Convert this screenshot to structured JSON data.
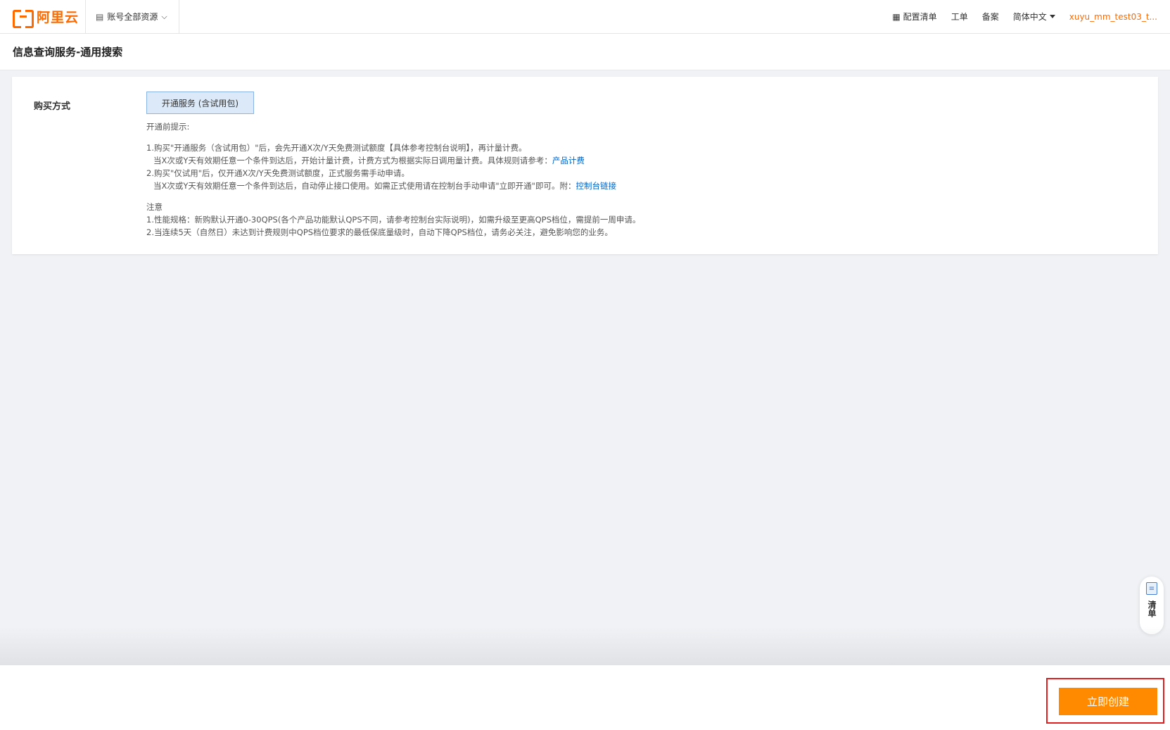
{
  "topbar": {
    "logo_text": "阿里云",
    "account_scope": "账号全部资源",
    "account_scope_icon": "server-list-icon",
    "nav": [
      {
        "label": "配置清单",
        "icon": "list-doc-icon"
      },
      {
        "label": "工单"
      },
      {
        "label": "备案"
      },
      {
        "label": "简体中文"
      }
    ],
    "user": "xuyu_mm_test03_t..."
  },
  "page": {
    "title": "信息查询服务-通用搜索"
  },
  "form": {
    "purchase_label": "购买方式",
    "option_label": "开通服务 (含试用包)",
    "notes": {
      "heading": "开通前提示:",
      "line1": "1.购买\"开通服务（含试用包）\"后，会先开通X次/Y天免费测试额度【具体参考控制台说明】，再计量计费。",
      "line2_prefix": "当X次或Y天有效期任意一个条件到达后，开始计量计费，计费方式为根据实际日调用量计费。具体规则请参考：",
      "line2_link": "产品计费",
      "line3": "2.购买\"仅试用\"后，仅开通X次/Y天免费测试额度，正式服务需手动申请。",
      "line4_prefix": "当X次或Y天有效期任意一个条件到达后，自动停止接口使用。如需正式使用请在控制台手动申请\"立即开通\"即可。附：",
      "line4_link": "控制台链接",
      "note_heading": "注意",
      "note1": "1.性能规格：新购默认开通0-30QPS(各个产品功能默认QPS不同，请参考控制台实际说明)，如需升级至更高QPS档位，需提前一周申请。",
      "note2": "2.当连续5天（自然日）未达到计费规则中QPS档位要求的最低保底量级时，自动下降QPS档位，请务必关注，避免影响您的业务。"
    }
  },
  "side_widget": {
    "label": "清单",
    "icon": "list-doc-icon"
  },
  "footer": {
    "create_label": "立即创建"
  },
  "colors": {
    "brand": "#ff6a00",
    "primary_button": "#ff8a00",
    "link": "#0064c8",
    "highlight_border": "#e02020"
  }
}
